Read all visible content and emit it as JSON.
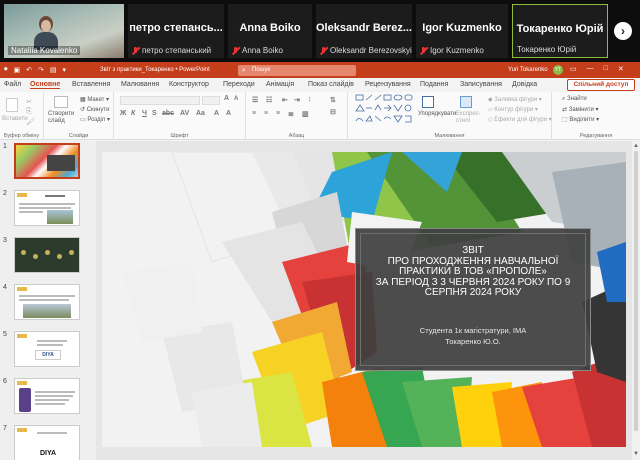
{
  "meeting": {
    "participants": [
      {
        "name": "Nataliia Kovalenko",
        "display_name": "",
        "muted": false,
        "video": true,
        "active": false
      },
      {
        "name": "петро степанський",
        "display_name": "петро степансь...",
        "muted": true,
        "video": false,
        "active": false
      },
      {
        "name": "Anna Boiko",
        "display_name": "Anna Boiko",
        "muted": true,
        "video": false,
        "active": false
      },
      {
        "name": "Oleksandr Berezovskyi",
        "display_name": "Oleksandr  Berez...",
        "muted": true,
        "video": false,
        "active": false
      },
      {
        "name": "Igor Kuzmenko",
        "display_name": "Igor Kuzmenko",
        "muted": true,
        "video": false,
        "active": false
      },
      {
        "name": "Токаренко Юрій",
        "display_name": "Токаренко Юрій",
        "muted": false,
        "video": false,
        "active": true
      }
    ],
    "next_icon": "chevron-right-icon"
  },
  "powerpoint": {
    "doc_title": "Звіт з практики_Токаренко  •  PowerPoint",
    "search_placeholder": "Пошук",
    "user_name": "Yuri Tokarenko",
    "user_initials": "YT",
    "accent": "#c43e1c",
    "tabs": [
      "Файл",
      "Основне",
      "Вставлення",
      "Малювання",
      "Конструктор",
      "Переходи",
      "Анімація",
      "Показ слайдів",
      "Рецензування",
      "Подання",
      "Записування",
      "Довідка"
    ],
    "active_tab": "Основне",
    "share_label": "Спільний доступ",
    "ribbon": {
      "paste_label": "Вставити",
      "create_slide_label": "Створити слайд",
      "layout_label": "Макет",
      "reset_label": "Скинути",
      "section_label": "Розділ",
      "arrange_label": "Упорядкувати",
      "styles_label": "Експрес-стилі",
      "fill_label": "Заливка фігури",
      "outline_label": "Контур фігури",
      "effects_label": "Ефекти для фігури",
      "find_label": "Знайти",
      "replace_label": "Замінити",
      "select_label": "Виділити",
      "groups": {
        "clipboard": "Буфер обміну",
        "slides": "Слайди",
        "font": "Шрифт",
        "paragraph": "Абзац",
        "drawing": "Малювання",
        "editing": "Редагування"
      }
    },
    "slide_numbers": [
      "1",
      "2",
      "3",
      "4",
      "5",
      "6",
      "7"
    ],
    "thumb_texts": {
      "t6_logo": "DIYA",
      "t7_logo": "DIYA"
    },
    "slide": {
      "title": "ЗВІТ\nПРО ПРОХОДЖЕННЯ НАВЧАЛЬНОЇ\nПРАКТИКИ В ТОВ «ПРОПОЛЕ»\nЗА ПЕРІОД З 3 ЧЕРВНЯ 2024 РОКУ ПО 9\nСЕРПНЯ 2024 РОКУ",
      "subtitle": "Студента 1к магістратури, ІМА\nТокаренко Ю.О."
    }
  }
}
